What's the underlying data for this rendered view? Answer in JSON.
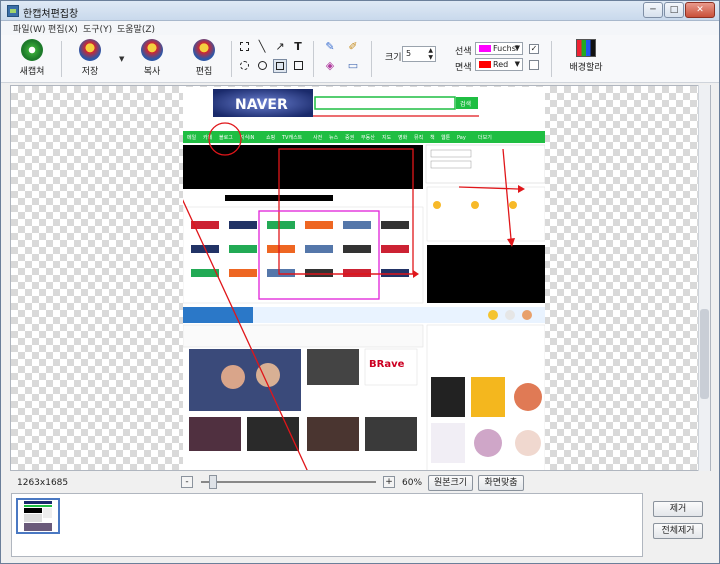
{
  "window": {
    "title": "한캡쳐편집창",
    "minimize": "─",
    "maximize": "□",
    "close": "✕"
  },
  "menu": [
    "파일(W)",
    "편집(X)",
    "도구(Y)",
    "도움말(Z)"
  ],
  "toolbar": {
    "new_capture": "새캡쳐",
    "save": "저장",
    "copy": "복사",
    "edit": "편집",
    "size_label": "크기",
    "size_value": "5",
    "line_color_label": "선색",
    "line_color_name": "Fuchsi",
    "line_color": "#ff00ff",
    "fill_color_label": "면색",
    "fill_color_name": "Red",
    "fill_color": "#ff0000",
    "line_color_checked": true,
    "fill_color_checked": false,
    "background_label": "배경할라"
  },
  "tools": [
    "select-rect",
    "line",
    "arrow",
    "text",
    "ellipse-select",
    "ellipse",
    "rect-outline",
    "rect-filled",
    "pen",
    "brush",
    "fill",
    "eraser"
  ],
  "naver": {
    "logo": "NAVER",
    "search_button": "검색",
    "nav_items": [
      "메일",
      "카페",
      "블로그",
      "지식iN",
      "쇼핑",
      "TV캐스트",
      "사전",
      "뉴스",
      "증권",
      "부동산",
      "지도",
      "영화",
      "뮤직",
      "책",
      "웹툰",
      "Pay",
      "더보기"
    ]
  },
  "status": {
    "dimensions": "1263x1685",
    "zoom_minus": "-",
    "zoom_plus": "+",
    "zoom": "60%",
    "original_size": "원본크기",
    "fit_screen": "화면맞춤"
  },
  "side_buttons": {
    "remove": "제거",
    "remove_all": "전체제거"
  },
  "colors": {
    "accent_green": "#1fbe42",
    "annotation_red": "#e0161a",
    "annotation_magenta": "#e020d8"
  }
}
